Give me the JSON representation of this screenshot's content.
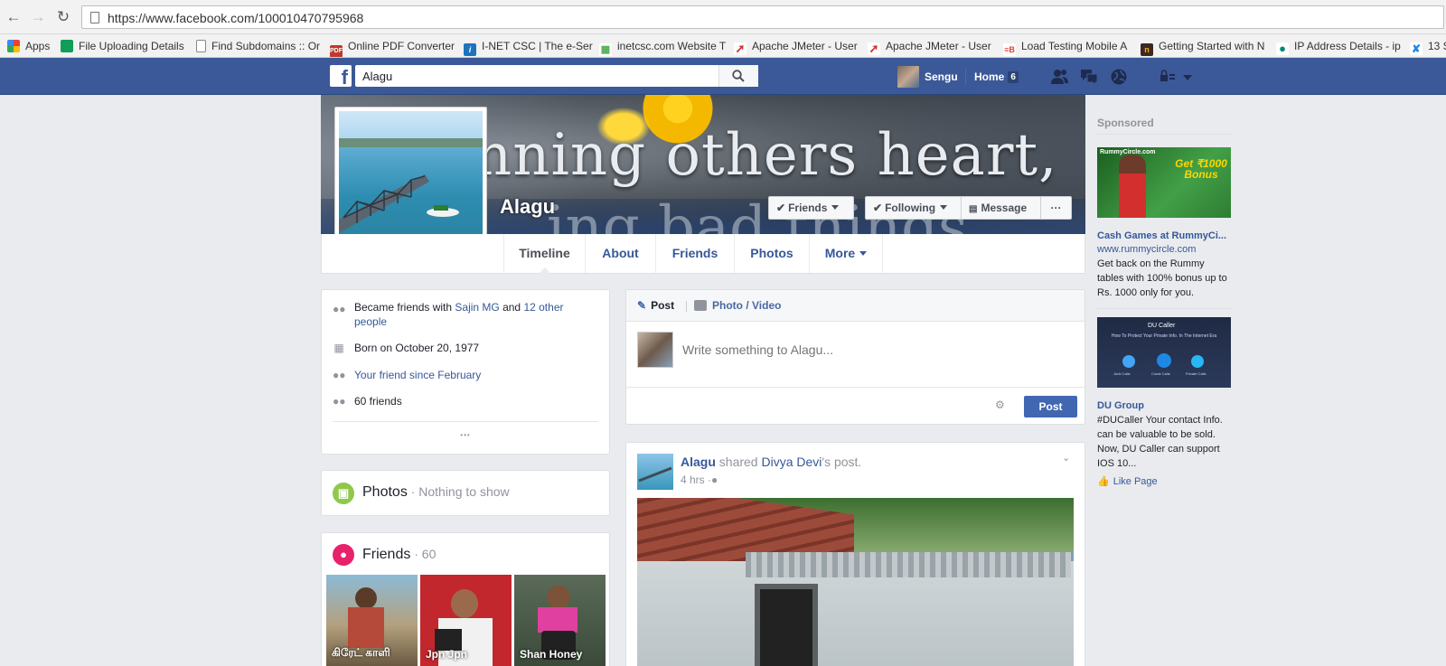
{
  "browser": {
    "url": "https://www.facebook.com/100010470795968",
    "bookmarks": [
      {
        "label": "Apps",
        "icon": "apps-grid-icon",
        "color": "#e84335"
      },
      {
        "label": "File Uploading Details",
        "icon": "sheets-icon",
        "color": "#0f9d58"
      },
      {
        "label": "Find Subdomains :: Or",
        "icon": "page-icon",
        "color": "#888888"
      },
      {
        "label": "Online PDF Converter",
        "icon": "pdf-icon",
        "color": "#c0392b"
      },
      {
        "label": "I-NET CSC | The e-Ser",
        "icon": "inet-icon",
        "color": "#1e73be"
      },
      {
        "label": "inetcsc.com Website T",
        "icon": "chart-icon",
        "color": "#4caf50"
      },
      {
        "label": "Apache JMeter - User",
        "icon": "feather-icon",
        "color": "#d32f2f"
      },
      {
        "label": "Apache JMeter - User",
        "icon": "feather-icon",
        "color": "#d32f2f"
      },
      {
        "label": "Load Testing Mobile A",
        "icon": "b-icon",
        "color": "#e53935"
      },
      {
        "label": "Getting Started with N",
        "icon": "nexus-icon",
        "color": "#e65100"
      },
      {
        "label": "IP Address Details - ip",
        "icon": "pin-icon",
        "color": "#00897b"
      },
      {
        "label": "13 S",
        "icon": "xpath-icon",
        "color": "#1e88e5"
      }
    ]
  },
  "fb": {
    "search_value": "Alagu",
    "user_name": "Sengu",
    "home_label": "Home",
    "home_count": "6"
  },
  "profile": {
    "name": "Alagu",
    "cover_text_line1": "nning others heart,",
    "cover_text_line2": "     ing bad things",
    "buttons": {
      "friends": "Friends",
      "following": "Following",
      "message": "Message",
      "more": "···"
    },
    "tabs": [
      "Timeline",
      "About",
      "Friends",
      "Photos",
      "More"
    ]
  },
  "intro": {
    "friends_prefix": "Became friends with ",
    "friends_name": "Sajin MG",
    "friends_and": " and ",
    "friends_others": "12 other people",
    "born": "Born on October 20, 1977",
    "friend_since": "Your friend since February",
    "friend_count": "60 friends",
    "more_dots": "•••"
  },
  "photos_card": {
    "title": "Photos",
    "subtitle": " · Nothing to show"
  },
  "friends_card": {
    "title": "Friends",
    "count": " · 60",
    "friends": [
      {
        "name": "கிரேட் காளி"
      },
      {
        "name": "Jpn Jpn"
      },
      {
        "name": "Shan Honey"
      }
    ]
  },
  "composer": {
    "post_tab": "Post",
    "photo_tab": "Photo / Video",
    "placeholder": "Write something to Alagu...",
    "post_button": "Post"
  },
  "feed_post": {
    "author": "Alagu",
    "action": " shared ",
    "target": "Divya Devi",
    "target_suffix": "'s post.",
    "time": "4 hrs"
  },
  "sidebar": {
    "sponsored": "Sponsored",
    "ads": [
      {
        "title": "Cash Games at RummyCi...",
        "url": "www.rummycircle.com",
        "text": "Get back on the Rummy tables with 100% bonus up to Rs. 1000 only for you.",
        "img_brand": "RummyCircle.com",
        "img_headline": "Get ₹1000 Bonus"
      },
      {
        "title": "DU Group",
        "text": "#DUCaller Your contact Info. can be valuable to be sold. Now, DU Caller can support IOS 10...",
        "like_label": "Like Page",
        "img_brand": "DU Caller",
        "img_headline": "How To Protect Your Private Info. In The Internet Era",
        "img_items": [
          "Junk Calls",
          "Crank Calls",
          "Private Calls"
        ]
      }
    ]
  },
  "colors": {
    "fb_blue": "#3b5998",
    "link": "#365899",
    "page_bg": "#e9ebee",
    "post_button": "#4267b2"
  }
}
